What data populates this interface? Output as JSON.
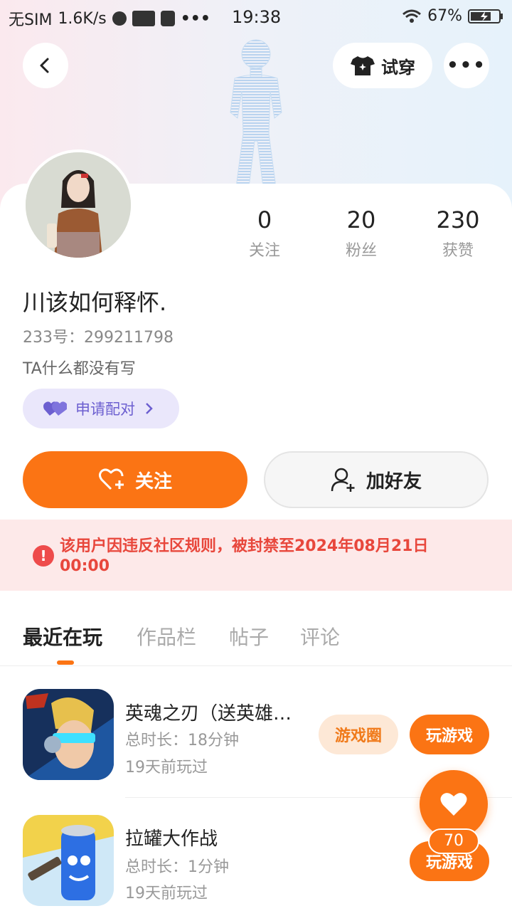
{
  "status_bar": {
    "carrier": "无SIM",
    "speed": "1.6K/s",
    "time": "19:38",
    "battery": "67%"
  },
  "header": {
    "try_on_label": "试穿"
  },
  "profile": {
    "stats": [
      {
        "value": "0",
        "label": "关注"
      },
      {
        "value": "20",
        "label": "粉丝"
      },
      {
        "value": "230",
        "label": "获赞"
      }
    ],
    "name": "川该如何释怀.",
    "uid": "233号：299211798",
    "bio": "TA什么都没有写",
    "pair_label": "申请配对"
  },
  "actions": {
    "follow_label": "关注",
    "add_friend_label": "加好友"
  },
  "ban_notice": "该用户因违反社区规则，被封禁至2024年08月21日 00:00",
  "tabs": [
    {
      "label": "最近在玩"
    },
    {
      "label": "作品栏"
    },
    {
      "label": "帖子"
    },
    {
      "label": "评论"
    }
  ],
  "games": [
    {
      "name": "英魂之刃（送英雄…",
      "duration": "总时长：18分钟",
      "last_played": "19天前玩过",
      "circle_label": "游戏圈",
      "play_label": "玩游戏"
    },
    {
      "name": "拉罐大作战",
      "duration": "总时长：1分钟",
      "last_played": "19天前玩过",
      "play_label": "玩游戏"
    }
  ],
  "like_fab": {
    "count": "70"
  },
  "colors": {
    "accent": "#fb7414",
    "ban_text": "#e8473c",
    "pair_text": "#6c5fd0"
  }
}
